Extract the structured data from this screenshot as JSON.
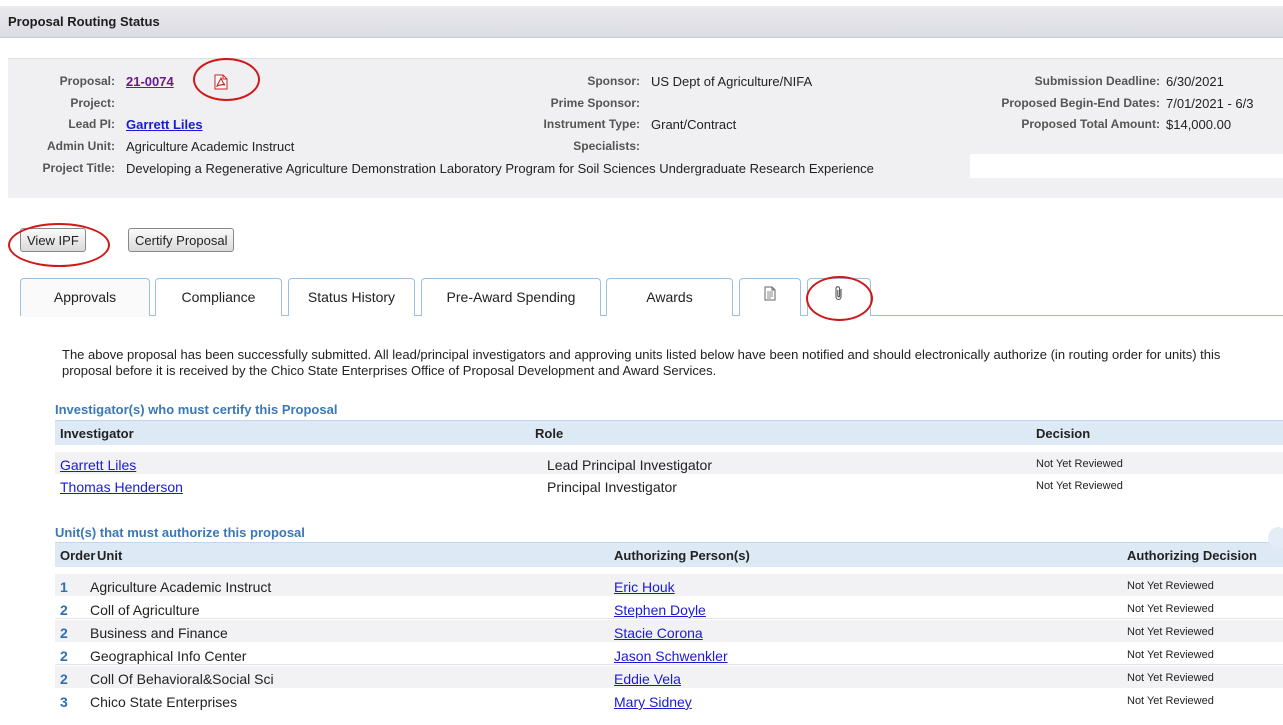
{
  "page": {
    "title": "Proposal Routing Status"
  },
  "proposal_info": {
    "proposal_label": "Proposal:",
    "proposal_value": "21-0074",
    "project_label": "Project:",
    "lead_pi_label": "Lead PI:",
    "lead_pi_value": "Garrett Liles",
    "admin_unit_label": "Admin Unit:",
    "admin_unit_value": "Agriculture Academic Instruct",
    "project_title_label": "Project Title:",
    "project_title_value": "Developing a Regenerative Agriculture Demonstration Laboratory Program for Soil Sciences Undergraduate Research Experience",
    "sponsor_label": "Sponsor:",
    "sponsor_value": "US Dept of Agriculture/NIFA",
    "prime_sponsor_label": "Prime Sponsor:",
    "instrument_type_label": "Instrument Type:",
    "instrument_type_value": "Grant/Contract",
    "specialists_label": "Specialists:",
    "submission_deadline_label": "Submission Deadline:",
    "submission_deadline_value": "6/30/2021",
    "proposed_dates_label": "Proposed Begin-End Dates:",
    "proposed_dates_value": "7/01/2021 - 6/3",
    "proposed_total_label": "Proposed Total Amount:",
    "proposed_total_value": "$14,000.00"
  },
  "actions": {
    "view_ipf": "View IPF",
    "certify_proposal": "Certify Proposal"
  },
  "tabs": [
    {
      "label": "Approvals"
    },
    {
      "label": "Compliance"
    },
    {
      "label": "Status History"
    },
    {
      "label": "Pre-Award Spending"
    },
    {
      "label": "Awards"
    },
    {
      "label": "",
      "icon": "document-icon"
    },
    {
      "label": "",
      "icon": "paperclip-icon"
    }
  ],
  "approvals": {
    "notice": "The above proposal has been successfully submitted. All lead/principal investigators and approving units listed below have been notified and should electronically authorize (in routing order for units) this proposal before it is received by the Chico State Enterprises Office of Proposal Development and Award Services.",
    "investigators_title": "Investigator(s) who must certify this Proposal",
    "investigators_headers": {
      "investigator": "Investigator",
      "role": "Role",
      "decision": "Decision"
    },
    "investigators": [
      {
        "name": "Garrett Liles",
        "role": "Lead Principal Investigator",
        "decision": "Not Yet Reviewed"
      },
      {
        "name": "Thomas Henderson",
        "role": "Principal Investigator",
        "decision": "Not Yet Reviewed"
      }
    ],
    "units_title": "Unit(s) that must authorize this proposal",
    "units_headers": {
      "order": "Order",
      "unit": "Unit",
      "person": "Authorizing Person(s)",
      "decision": "Authorizing Decision"
    },
    "units": [
      {
        "order": "1",
        "unit": "Agriculture Academic Instruct",
        "person": "Eric Houk",
        "decision": "Not Yet Reviewed"
      },
      {
        "order": "2",
        "unit": "Coll of Agriculture",
        "person": "Stephen Doyle",
        "decision": "Not Yet Reviewed"
      },
      {
        "order": "2",
        "unit": "Business and Finance",
        "person": "Stacie Corona",
        "decision": "Not Yet Reviewed"
      },
      {
        "order": "2",
        "unit": "Geographical Info Center",
        "person": "Jason Schwenkler",
        "decision": "Not Yet Reviewed"
      },
      {
        "order": "2",
        "unit": "Coll Of Behavioral&Social Sci",
        "person": "Eddie Vela",
        "decision": "Not Yet Reviewed"
      },
      {
        "order": "3",
        "unit": "Chico State Enterprises",
        "person": "Mary Sidney",
        "decision": "Not Yet Reviewed"
      }
    ]
  },
  "colors": {
    "annotation": "#d01818",
    "link": "#1a1ad6",
    "section": "#3a78b8",
    "tab_border": "#9cc0e0"
  }
}
